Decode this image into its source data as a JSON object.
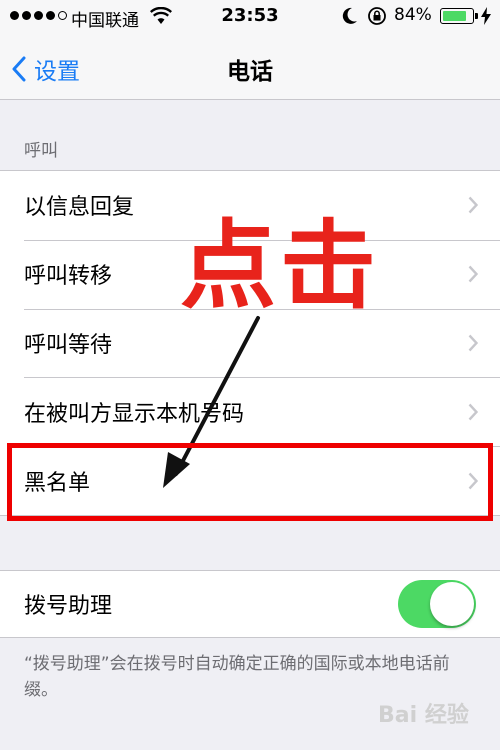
{
  "status_bar": {
    "carrier": "中国联通",
    "time": "23:53",
    "battery_percent": "84%",
    "battery_level": 0.84,
    "signal_bars_filled": 4,
    "signal_bars_total": 5
  },
  "nav": {
    "back_label": "设置",
    "title": "电话"
  },
  "calls_section": {
    "header": "呼叫",
    "items": [
      {
        "label": "以信息回复"
      },
      {
        "label": "呼叫转移"
      },
      {
        "label": "呼叫等待"
      },
      {
        "label": "在被叫方显示本机号码"
      },
      {
        "label": "黑名单"
      }
    ]
  },
  "dial_assist": {
    "label": "拨号助理",
    "enabled": true,
    "footer": "“拨号助理”会在拨号时自动确定正确的国际或本地电话前缀。"
  },
  "annotation": {
    "text": "点击",
    "color": "#e8231b"
  },
  "watermark": "Bai 经验",
  "colors": {
    "accent": "#1a7cf5",
    "toggle_on": "#4cd964",
    "highlight": "#ee0000"
  }
}
